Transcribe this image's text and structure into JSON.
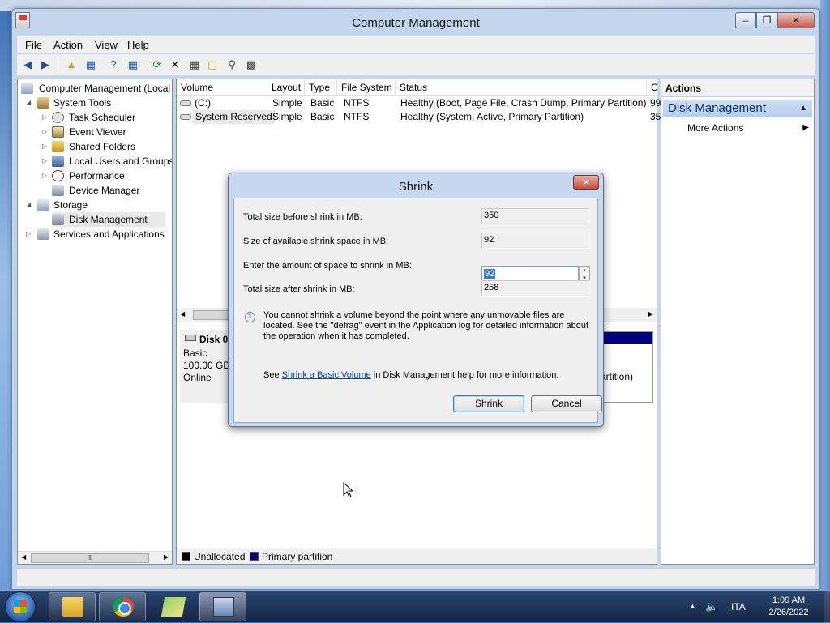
{
  "window": {
    "title": "Computer Management"
  },
  "menu": [
    "File",
    "Action",
    "View",
    "Help"
  ],
  "tree": {
    "root": "Computer Management (Local",
    "system_tools": "System Tools",
    "task_scheduler": "Task Scheduler",
    "event_viewer": "Event Viewer",
    "shared_folders": "Shared Folders",
    "local_users": "Local Users and Groups",
    "performance": "Performance",
    "device_manager": "Device Manager",
    "storage": "Storage",
    "disk_management": "Disk Management",
    "services": "Services and Applications",
    "scroll_grip": "III"
  },
  "volume_list": {
    "headers": [
      "Volume",
      "Layout",
      "Type",
      "File System",
      "Status",
      "C"
    ],
    "rows": [
      [
        "(C:)",
        "Simple",
        "Basic",
        "NTFS",
        "Healthy (Boot, Page File, Crash Dump, Primary Partition)",
        "99"
      ],
      [
        "System Reserved",
        "Simple",
        "Basic",
        "NTFS",
        "Healthy (System, Active, Primary Partition)",
        "35"
      ]
    ]
  },
  "disk": {
    "name": "Disk 0",
    "type": "Basic",
    "size": "100.00 GB",
    "state": "Online",
    "partition_fragment": "artition)"
  },
  "legend": {
    "unallocated": "Unallocated",
    "primary": "Primary partition",
    "unallocated_color": "#000000",
    "primary_color": "#00007f"
  },
  "actions": {
    "header": "Actions",
    "section": "Disk Management",
    "more": "More Actions"
  },
  "dialog": {
    "title": "Shrink",
    "total_before_label": "Total size before shrink in MB:",
    "total_before_value": "350",
    "available_label": "Size of available shrink space in MB:",
    "available_value": "92",
    "amount_label": "Enter the amount of space to shrink in MB:",
    "amount_value": "92",
    "total_after_label": "Total size after shrink in MB:",
    "total_after_value": "258",
    "info_text": "You cannot shrink a volume beyond the point where any unmovable files are located. See the \"defrag\" event in the Application log for detailed information about the operation when it has completed.",
    "help_prefix": "See",
    "help_link": "Shrink a Basic Volume",
    "help_suffix": "in Disk Management help for more information.",
    "shrink_button": "Shrink",
    "cancel_button": "Cancel"
  },
  "taskbar": {
    "language": "ITA",
    "time": "1:09 AM",
    "date": "2/26/2022"
  }
}
